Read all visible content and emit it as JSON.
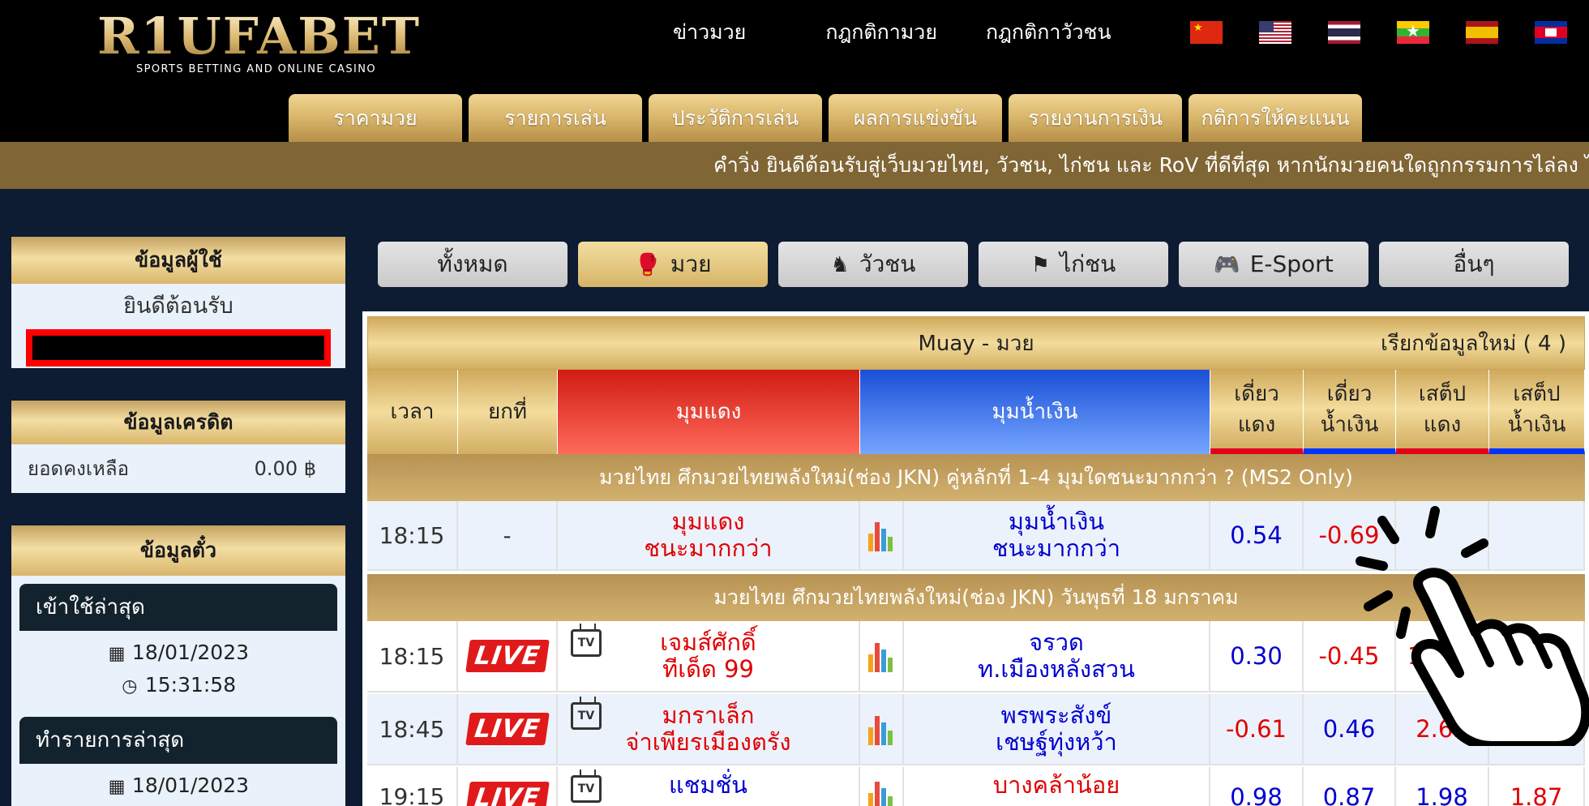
{
  "header": {
    "logo_text": "R1UFABET",
    "logo_sub": "SPORTS BETTING AND ONLINE CASINO",
    "nav": [
      "ข่าวมวย",
      "กฎกติกามวย",
      "กฎกติกาวัวชน"
    ],
    "flags": [
      "china-flag-icon",
      "usa-flag-icon",
      "thailand-flag-icon",
      "myanmar-flag-icon",
      "spain-flag-icon",
      "cambodia-flag-icon"
    ]
  },
  "main_tabs": [
    "ราคามวย",
    "รายการเล่น",
    "ประวัติการเล่น",
    "ผลการแข่งขัน",
    "รายงานการเงิน",
    "กติการให้คะแนน"
  ],
  "ticker": "คำวิ่ง ยินดีต้อนรับสู่เว็บมวยไทย, วัวชน, ไก่ชน และ RoV ที่ดีที่สุด หากนักมวยคนใดถูกกรรมการไล่ลง ไ",
  "user_panel": {
    "title": "ข้อมูลผู้ใช้",
    "welcome": "ยินดีต้อนรับ"
  },
  "credit_panel": {
    "title": "ข้อมูลเครดิต",
    "balance_label": "ยอดคงเหลือ",
    "balance_value": "0.00 ฿"
  },
  "ticket_panel": {
    "title": "ข้อมูลตั๋ว",
    "last_login_label": "เข้าใช้ล่าสุด",
    "last_login_date": "18/01/2023",
    "last_login_time": "15:31:58",
    "last_tx_label": "ทำรายการล่าสุด",
    "last_tx_date": "18/01/2023"
  },
  "categories": [
    {
      "label": "ทั้งหมด",
      "icon": ""
    },
    {
      "label": "มวย",
      "icon": "boxing-glove-icon",
      "active": true
    },
    {
      "label": "วัวชน",
      "icon": "bull-icon"
    },
    {
      "label": "ไก่ชน",
      "icon": "rooster-icon"
    },
    {
      "label": "E-Sport",
      "icon": "gamepad-icon"
    },
    {
      "label": "อื่นๆ",
      "icon": ""
    }
  ],
  "table": {
    "title": "Muay - มวย",
    "refresh": "เรียกข้อมูลใหม่ ( 4 )",
    "columns": {
      "time": "เวลา",
      "round": "ยกที่",
      "red": "มุมแดง",
      "blue": "มุมน้ำเงิน",
      "single_red_1": "เดี่ยว",
      "single_red_2": "แดง",
      "single_blue_1": "เดี่ยว",
      "single_blue_2": "น้ำเงิน",
      "step_red_1": "เสต็ป",
      "step_red_2": "แดง",
      "step_blue_1": "เสต็ป",
      "step_blue_2": "น้ำเงิน"
    },
    "section1": "มวยไทย ศึกมวยไทยพลังใหม่(ช่อง JKN) คู่หลักที่ 1-4 มุมใดชนะมากกว่า ? (MS2 Only)",
    "row1": {
      "time": "18:15",
      "round": "-",
      "red_1": "มุมแดง",
      "red_2": "ชนะมากกว่า",
      "blue_1": "มุมน้ำเงิน",
      "blue_2": "ชนะมากกว่า",
      "o1": "0.54",
      "o2": "-0.69",
      "o3": "",
      "o4": ""
    },
    "section2": "มวยไทย ศึกมวยไทยพลังใหม่(ช่อง JKN) วันพุธที่ 18 มกราคม",
    "row2": {
      "time": "18:15",
      "live": "LIVE",
      "tv": "TV",
      "red_1": "เจมส์ศักดิ์",
      "red_2": "ทีเด็ด 99",
      "blue_1": "จรวด",
      "blue_2": "ท.เมืองหลังสวน",
      "o1": "0.30",
      "o2": "-0.45",
      "o3": "1.2"
    },
    "row3": {
      "time": "18:45",
      "live": "LIVE",
      "tv": "TV",
      "red_1": "มกราเล็ก",
      "red_2": "จ่าเพียรเมืองตรัง",
      "blue_1": "พรพระสังข์",
      "blue_2": "เชษฐ์ทุ่งหว้า",
      "o1": "-0.61",
      "o2": "0.46",
      "o3": "2.63",
      "o4": "1.6"
    },
    "row4": {
      "time": "19:15",
      "live": "LIVE",
      "tv": "TV",
      "red_1": "แชมชั่น",
      "blue_1": "บางคล้าน้อย",
      "o1": "0.98",
      "o2": "0.87",
      "o3": "1.98",
      "o4": "1.87"
    }
  },
  "colors": {
    "gold": "#d9b66c",
    "navy": "#0d1b33",
    "red": "#e00000",
    "blue": "#0000d0"
  }
}
